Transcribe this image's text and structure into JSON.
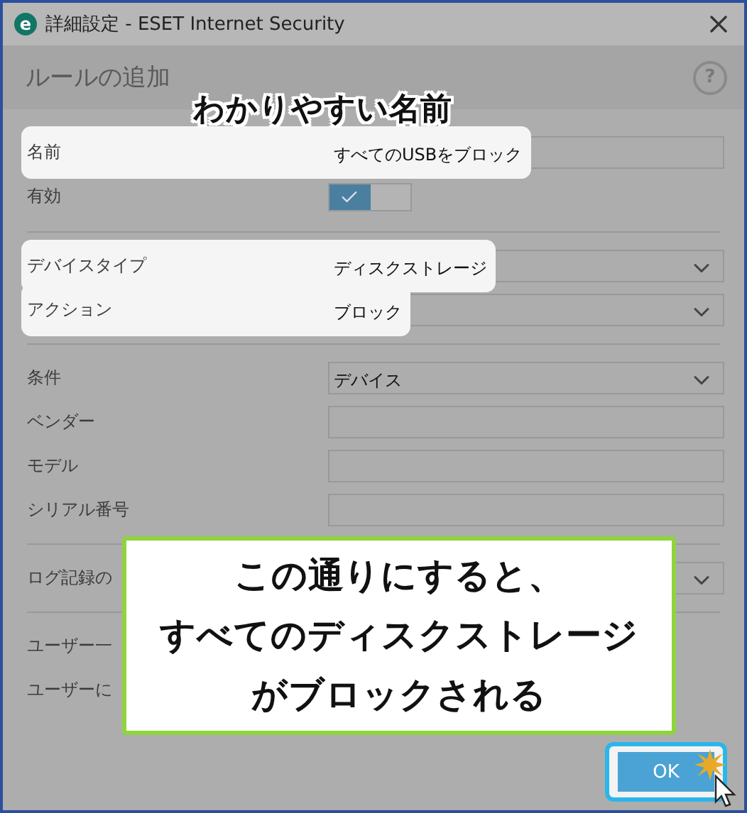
{
  "window": {
    "app_logo": "e",
    "title": "詳細設定 - ESET Internet Security"
  },
  "header": {
    "title": "ルールの追加",
    "help": "?"
  },
  "sections": [
    {
      "rows": [
        {
          "kind": "text",
          "label": "名前",
          "value": "すべてのUSBをブロック",
          "highlighted": true
        },
        {
          "kind": "toggle",
          "label": "有効",
          "on": true
        }
      ]
    },
    {
      "rows": [
        {
          "kind": "dropdown",
          "label": "デバイスタイプ",
          "value": "ディスクストレージ",
          "highlighted": true
        },
        {
          "kind": "dropdown",
          "label": "アクション",
          "value": "ブロック",
          "highlighted": true
        }
      ]
    },
    {
      "rows": [
        {
          "kind": "dropdown",
          "label": "条件",
          "value": "デバイス"
        },
        {
          "kind": "text",
          "label": "ベンダー"
        },
        {
          "kind": "text",
          "label": "モデル"
        },
        {
          "kind": "text",
          "label": "シリアル番号"
        }
      ]
    },
    {
      "rows": [
        {
          "kind": "dropdown",
          "label": "ログ記録の"
        }
      ]
    },
    {
      "rows": [
        {
          "kind": "none",
          "label": "ユーザー一"
        },
        {
          "kind": "none",
          "label": "ユーザーに"
        }
      ]
    }
  ],
  "annotations": {
    "title_callout": "わかりやすい名前",
    "note_lines": [
      "この通りにすると、",
      "すべてのディスクストレージ",
      "がブロックされる"
    ]
  },
  "footer": {
    "ok_button": "OK",
    "ok_highlighted": true
  }
}
